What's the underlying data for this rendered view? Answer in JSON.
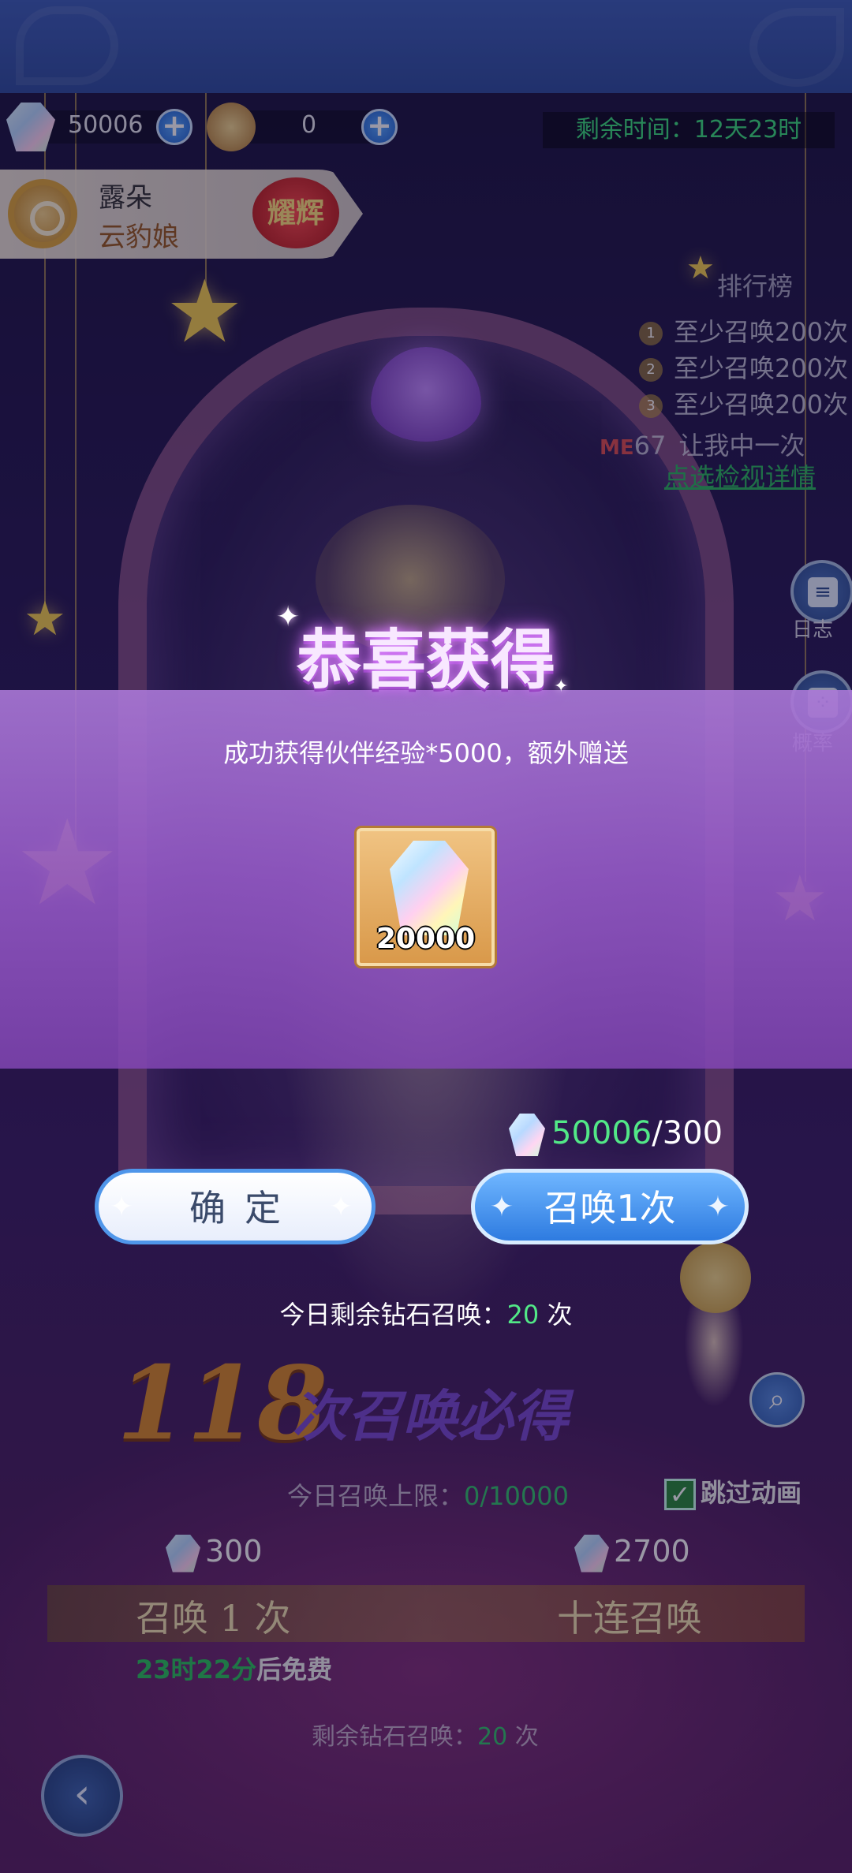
{
  "header": {
    "gems_value": "50006",
    "tickets_value": "0",
    "timer_text": "剩余时间：12天23时"
  },
  "character": {
    "name": "露朵",
    "title": "云豹娘",
    "rank_badge": "耀辉"
  },
  "ranking": {
    "title": "排行榜",
    "rows": [
      {
        "num": "1",
        "text": "至少召唤200次"
      },
      {
        "num": "2",
        "text": "至少召唤200次"
      },
      {
        "num": "3",
        "text": "至少召唤200次"
      }
    ],
    "me_tag": "ME",
    "me_rank": "67",
    "me_text": "让我中一次",
    "detail_link": "点选检视详情"
  },
  "side_buttons": {
    "log_label": "日志",
    "prob_label": "概率"
  },
  "background": {
    "guarantee_number": "118",
    "guarantee_text": "次召唤必得",
    "limit_label": "今日召唤上限：",
    "limit_value": "0/10000",
    "skip_label": "跳过动画",
    "cost_single": "300",
    "cost_ten": "2700",
    "summon_one_label": "召唤 1 次",
    "summon_ten_label": "十连召唤",
    "free_time": "23时22分",
    "free_suffix": "后免费",
    "remain_label": "剩余钻石召唤：",
    "remain_value": "20",
    "remain_unit": "次"
  },
  "dialog": {
    "title": "恭喜获得",
    "message": "成功获得伙伴经验*5000，额外赠送",
    "item_count": "20000",
    "balance_current": "50006",
    "balance_cost": "/300",
    "confirm_label": "确定",
    "summon_label": "召唤1次",
    "daily_label": "今日剩余钻石召唤：",
    "daily_value": "20",
    "daily_unit": "次"
  },
  "colors": {
    "accent_green": "#52e887",
    "button_blue": "#2e7be0",
    "item_frame": "#d9994a",
    "dialog_band": "#9a60d0"
  }
}
